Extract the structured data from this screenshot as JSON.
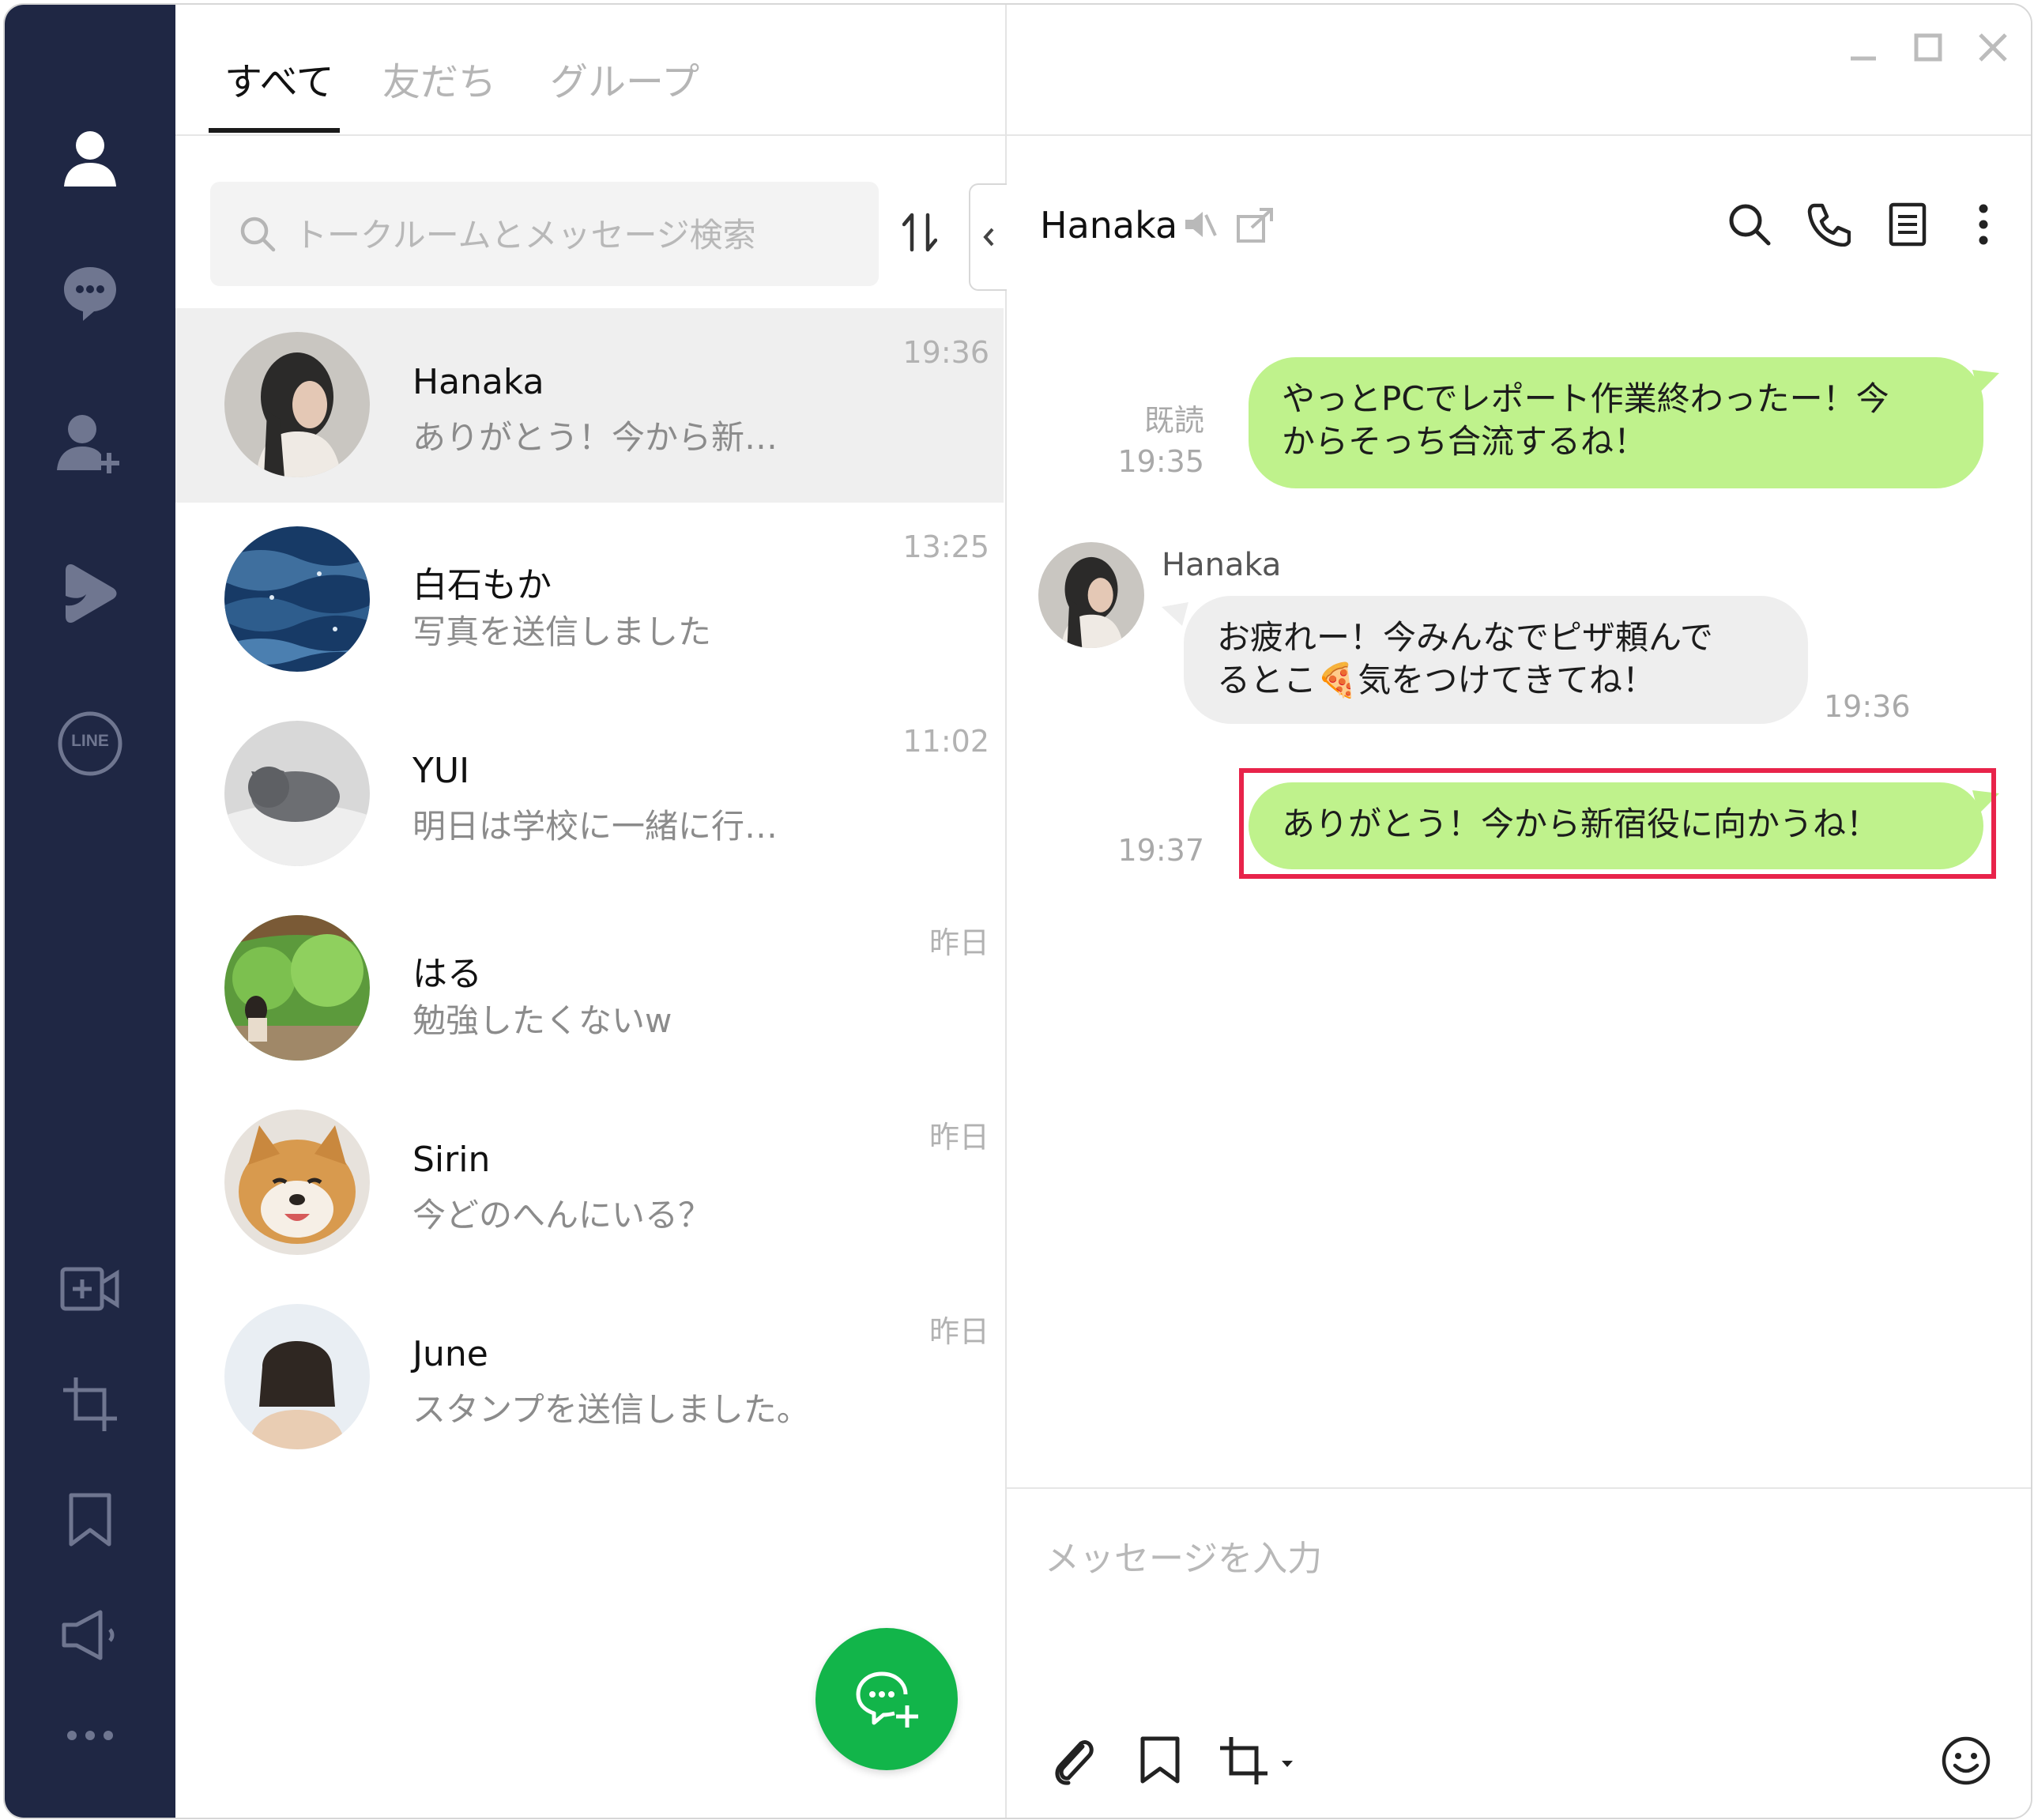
{
  "tabs": {
    "all": "すべて",
    "friends": "友だち",
    "groups": "グループ"
  },
  "search": {
    "placeholder": "トークルームとメッセージ検索"
  },
  "chats": [
    {
      "name": "Hanaka",
      "preview": "ありがとう！今から新…",
      "time": "19:36"
    },
    {
      "name": "白石もか",
      "preview": "写真を送信しました",
      "time": "13:25"
    },
    {
      "name": "YUI",
      "preview": "明日は学校に一緒に行…",
      "time": "11:02"
    },
    {
      "name": "はる",
      "preview": "勉強したくないw",
      "time": "昨日"
    },
    {
      "name": "Sirin",
      "preview": "今どのへんにいる？",
      "time": "昨日"
    },
    {
      "name": "June",
      "preview": "スタンプを送信しました。",
      "time": "昨日"
    }
  ],
  "conversation": {
    "title": "Hanaka",
    "messages": [
      {
        "from": "me",
        "line1": "やっとPCでレポート作業終わったー！今",
        "line2": "からそっち合流するね！",
        "read": "既読",
        "time": "19:35"
      },
      {
        "from": "Hanaka",
        "sender": "Hanaka",
        "line1": "お疲れー！今みんなでピザ頼んで",
        "line2a": "るとこ",
        "emoji": "🍕",
        "line2b": "気をつけてきてね！",
        "time": "19:36"
      },
      {
        "from": "me",
        "line1": "ありがとう！今から新宿役に向かうね！",
        "time": "19:37"
      }
    ]
  },
  "composer": {
    "placeholder": "メッセージを入力"
  },
  "nav": {
    "line_badge": "LINE"
  },
  "colors": {
    "sidebar": "#1f2744",
    "my_bubble": "#bff28c",
    "their_bubble": "#eeeeee",
    "fab": "#12b54a",
    "highlight": "#e8234a"
  }
}
